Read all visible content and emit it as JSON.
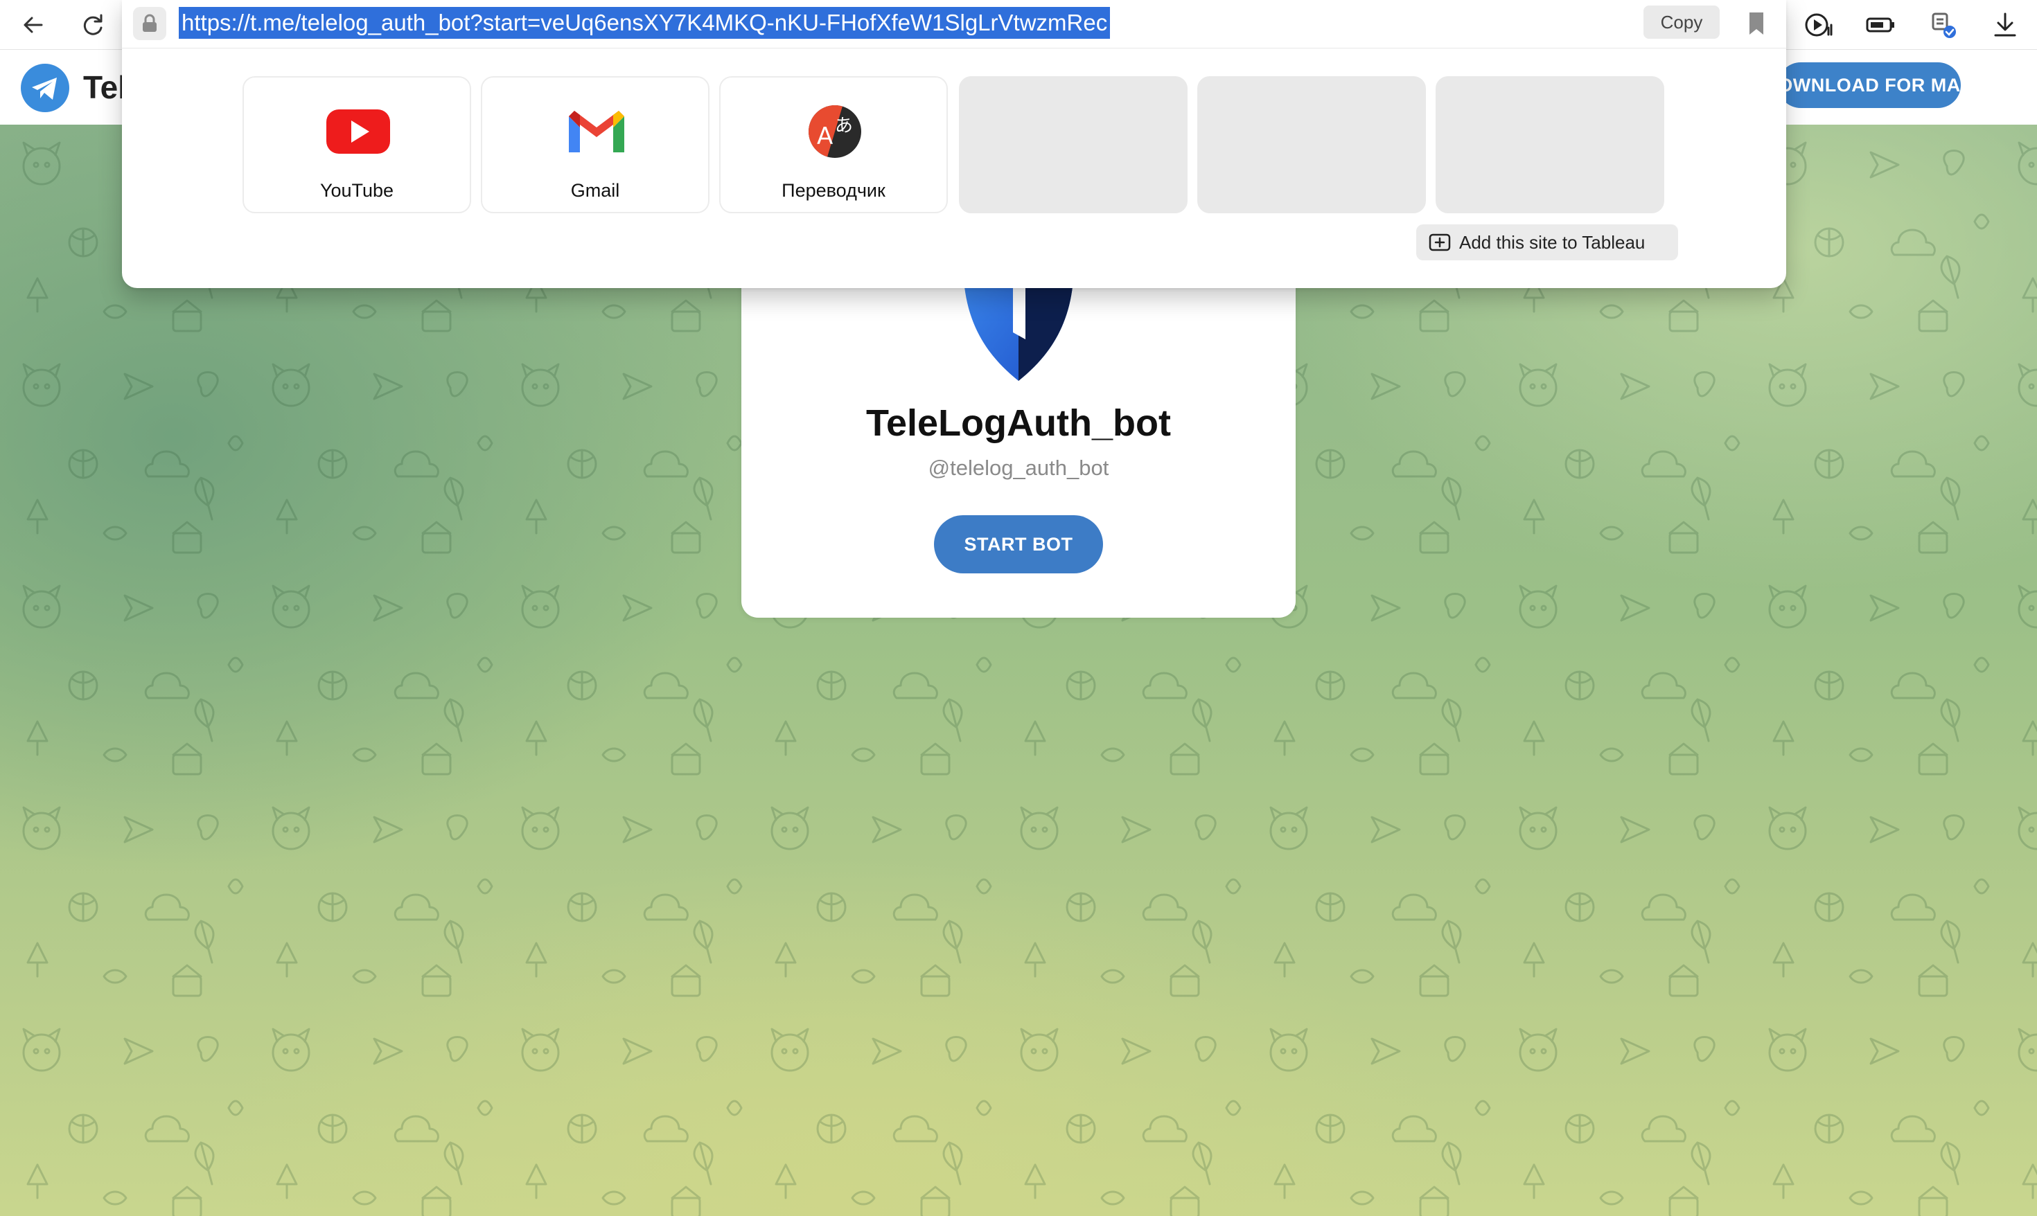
{
  "browser": {
    "url": "https://t.me/telelog_auth_bot?start=veUq6ensXY7K4MKQ-nKU-FHofXfeW1SlgLrVtwzmRec",
    "copy_label": "Copy",
    "toolbar_icons": [
      "back-icon",
      "reload-icon",
      "lock-icon",
      "bookmark-icon",
      "media-play-icon",
      "battery-icon",
      "extension-icon",
      "download-icon"
    ]
  },
  "tableau": {
    "tiles": [
      {
        "label": "YouTube",
        "icon": "youtube-icon"
      },
      {
        "label": "Gmail",
        "icon": "gmail-icon"
      },
      {
        "label": "Переводчик",
        "icon": "translator-icon"
      },
      {
        "label": "",
        "icon": ""
      },
      {
        "label": "",
        "icon": ""
      },
      {
        "label": "",
        "icon": ""
      }
    ],
    "add_site_label": "Add this site to Tableau"
  },
  "telegram": {
    "brand": "Tel",
    "download_label": "DOWNLOAD FOR MAC",
    "bot_name": "TeleLogAuth_bot",
    "bot_username": "@telelog_auth_bot",
    "start_label": "START BOT"
  },
  "colors": {
    "accent": "#3d7cc6",
    "url_selection": "#2f6fdb",
    "telegram_blue": "#3a8cdc"
  }
}
